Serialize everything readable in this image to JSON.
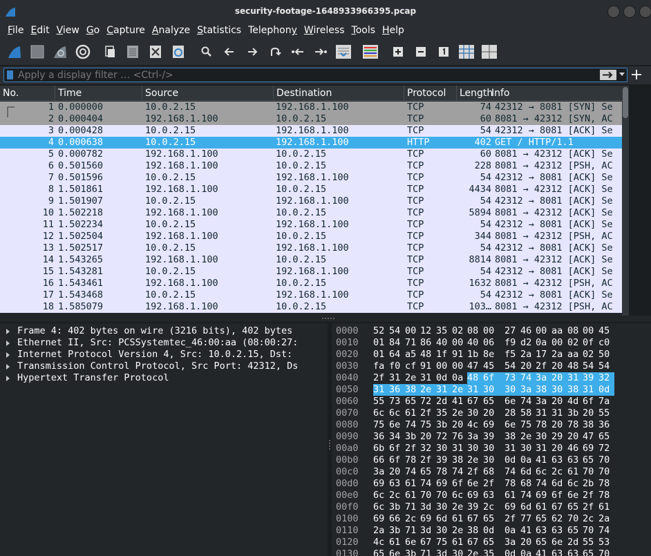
{
  "window": {
    "title": "security-footage-1648933966395.pcap"
  },
  "menu": [
    {
      "pre": "",
      "u": "F",
      "post": "ile"
    },
    {
      "pre": "",
      "u": "E",
      "post": "dit"
    },
    {
      "pre": "",
      "u": "V",
      "post": "iew"
    },
    {
      "pre": "",
      "u": "G",
      "post": "o"
    },
    {
      "pre": "",
      "u": "C",
      "post": "apture"
    },
    {
      "pre": "",
      "u": "A",
      "post": "nalyze"
    },
    {
      "pre": "",
      "u": "S",
      "post": "tatistics"
    },
    {
      "pre": "Telephon",
      "u": "y",
      "post": ""
    },
    {
      "pre": "",
      "u": "W",
      "post": "ireless"
    },
    {
      "pre": "",
      "u": "T",
      "post": "ools"
    },
    {
      "pre": "",
      "u": "H",
      "post": "elp"
    }
  ],
  "filter": {
    "placeholder": "Apply a display filter … <Ctrl-/>"
  },
  "columns": [
    "No.",
    "Time",
    "Source",
    "Destination",
    "Protocol",
    "Length",
    "Info"
  ],
  "packets": [
    {
      "no": "1",
      "time": "0.000000",
      "src": "10.0.2.15",
      "dst": "192.168.1.100",
      "proto": "TCP",
      "len": "74",
      "info": "42312 → 8081 [SYN] Se"
    },
    {
      "no": "2",
      "time": "0.000404",
      "src": "192.168.1.100",
      "dst": "10.0.2.15",
      "proto": "TCP",
      "len": "60",
      "info": "8081 → 42312 [SYN, AC"
    },
    {
      "no": "3",
      "time": "0.000428",
      "src": "10.0.2.15",
      "dst": "192.168.1.100",
      "proto": "TCP",
      "len": "54",
      "info": "42312 → 8081 [ACK] Se"
    },
    {
      "no": "4",
      "time": "0.000638",
      "src": "10.0.2.15",
      "dst": "192.168.1.100",
      "proto": "HTTP",
      "len": "402",
      "info": "GET / HTTP/1.1"
    },
    {
      "no": "5",
      "time": "0.000782",
      "src": "192.168.1.100",
      "dst": "10.0.2.15",
      "proto": "TCP",
      "len": "60",
      "info": "8081 → 42312 [ACK] Se"
    },
    {
      "no": "6",
      "time": "0.501560",
      "src": "192.168.1.100",
      "dst": "10.0.2.15",
      "proto": "TCP",
      "len": "228",
      "info": "8081 → 42312 [PSH, AC"
    },
    {
      "no": "7",
      "time": "0.501596",
      "src": "10.0.2.15",
      "dst": "192.168.1.100",
      "proto": "TCP",
      "len": "54",
      "info": "42312 → 8081 [ACK] Se"
    },
    {
      "no": "8",
      "time": "1.501861",
      "src": "192.168.1.100",
      "dst": "10.0.2.15",
      "proto": "TCP",
      "len": "4434",
      "info": "8081 → 42312 [ACK] Se"
    },
    {
      "no": "9",
      "time": "1.501907",
      "src": "10.0.2.15",
      "dst": "192.168.1.100",
      "proto": "TCP",
      "len": "54",
      "info": "42312 → 8081 [ACK] Se"
    },
    {
      "no": "10",
      "time": "1.502218",
      "src": "192.168.1.100",
      "dst": "10.0.2.15",
      "proto": "TCP",
      "len": "5894",
      "info": "8081 → 42312 [ACK] Se"
    },
    {
      "no": "11",
      "time": "1.502234",
      "src": "10.0.2.15",
      "dst": "192.168.1.100",
      "proto": "TCP",
      "len": "54",
      "info": "42312 → 8081 [ACK] Se"
    },
    {
      "no": "12",
      "time": "1.502504",
      "src": "192.168.1.100",
      "dst": "10.0.2.15",
      "proto": "TCP",
      "len": "344",
      "info": "8081 → 42312 [PSH, AC"
    },
    {
      "no": "13",
      "time": "1.502517",
      "src": "10.0.2.15",
      "dst": "192.168.1.100",
      "proto": "TCP",
      "len": "54",
      "info": "42312 → 8081 [ACK] Se"
    },
    {
      "no": "14",
      "time": "1.543265",
      "src": "192.168.1.100",
      "dst": "10.0.2.15",
      "proto": "TCP",
      "len": "8814",
      "info": "8081 → 42312 [ACK] Se"
    },
    {
      "no": "15",
      "time": "1.543281",
      "src": "10.0.2.15",
      "dst": "192.168.1.100",
      "proto": "TCP",
      "len": "54",
      "info": "42312 → 8081 [ACK] Se"
    },
    {
      "no": "16",
      "time": "1.543461",
      "src": "192.168.1.100",
      "dst": "10.0.2.15",
      "proto": "TCP",
      "len": "1632",
      "info": "8081 → 42312 [PSH, AC"
    },
    {
      "no": "17",
      "time": "1.543468",
      "src": "10.0.2.15",
      "dst": "192.168.1.100",
      "proto": "TCP",
      "len": "54",
      "info": "42312 → 8081 [ACK] Se"
    },
    {
      "no": "18",
      "time": "1.585079",
      "src": "192.168.1.100",
      "dst": "10.0.2.15",
      "proto": "TCP",
      "len": "103…",
      "info": "8081 → 42312 [PSH, AC"
    }
  ],
  "details": [
    "Frame 4: 402 bytes on wire (3216 bits), 402 bytes",
    "Ethernet II, Src: PCSSystemtec_46:00:aa (08:00:27:",
    "Internet Protocol Version 4, Src: 10.0.2.15, Dst:",
    "Transmission Control Protocol, Src Port: 42312, Ds",
    "Hypertext Transfer Protocol"
  ],
  "bytes": [
    {
      "off": "0000",
      "hex": [
        "52",
        "54",
        "00",
        "12",
        "35",
        "02",
        "08",
        "00",
        "27",
        "46",
        "00",
        "aa",
        "08",
        "00",
        "45"
      ]
    },
    {
      "off": "0010",
      "hex": [
        "01",
        "84",
        "71",
        "86",
        "40",
        "00",
        "40",
        "06",
        "f9",
        "d2",
        "0a",
        "00",
        "02",
        "0f",
        "c0"
      ]
    },
    {
      "off": "0020",
      "hex": [
        "01",
        "64",
        "a5",
        "48",
        "1f",
        "91",
        "1b",
        "8e",
        "f5",
        "2a",
        "17",
        "2a",
        "aa",
        "02",
        "50"
      ]
    },
    {
      "off": "0030",
      "hex": [
        "fa",
        "f0",
        "cf",
        "91",
        "00",
        "00",
        "47",
        "45",
        "54",
        "20",
        "2f",
        "20",
        "48",
        "54",
        "54"
      ]
    },
    {
      "off": "0040",
      "hex": [
        "2f",
        "31",
        "2e",
        "31",
        "0d",
        "0a",
        "48",
        "6f",
        "73",
        "74",
        "3a",
        "20",
        "31",
        "39",
        "32"
      ]
    },
    {
      "off": "0050",
      "hex": [
        "31",
        "36",
        "38",
        "2e",
        "31",
        "2e",
        "31",
        "30",
        "30",
        "3a",
        "38",
        "30",
        "38",
        "31",
        "0d"
      ]
    },
    {
      "off": "0060",
      "hex": [
        "55",
        "73",
        "65",
        "72",
        "2d",
        "41",
        "67",
        "65",
        "6e",
        "74",
        "3a",
        "20",
        "4d",
        "6f",
        "7a"
      ]
    },
    {
      "off": "0070",
      "hex": [
        "6c",
        "6c",
        "61",
        "2f",
        "35",
        "2e",
        "30",
        "20",
        "28",
        "58",
        "31",
        "31",
        "3b",
        "20",
        "55"
      ]
    },
    {
      "off": "0080",
      "hex": [
        "75",
        "6e",
        "74",
        "75",
        "3b",
        "20",
        "4c",
        "69",
        "6e",
        "75",
        "78",
        "20",
        "78",
        "38",
        "36"
      ]
    },
    {
      "off": "0090",
      "hex": [
        "36",
        "34",
        "3b",
        "20",
        "72",
        "76",
        "3a",
        "39",
        "38",
        "2e",
        "30",
        "29",
        "20",
        "47",
        "65"
      ]
    },
    {
      "off": "00a0",
      "hex": [
        "6b",
        "6f",
        "2f",
        "32",
        "30",
        "31",
        "30",
        "30",
        "31",
        "30",
        "31",
        "20",
        "46",
        "69",
        "72"
      ]
    },
    {
      "off": "00b0",
      "hex": [
        "66",
        "6f",
        "78",
        "2f",
        "39",
        "38",
        "2e",
        "30",
        "0d",
        "0a",
        "41",
        "63",
        "63",
        "65",
        "70"
      ]
    },
    {
      "off": "00c0",
      "hex": [
        "3a",
        "20",
        "74",
        "65",
        "78",
        "74",
        "2f",
        "68",
        "74",
        "6d",
        "6c",
        "2c",
        "61",
        "70",
        "70"
      ]
    },
    {
      "off": "00d0",
      "hex": [
        "69",
        "63",
        "61",
        "74",
        "69",
        "6f",
        "6e",
        "2f",
        "78",
        "68",
        "74",
        "6d",
        "6c",
        "2b",
        "78"
      ]
    },
    {
      "off": "00e0",
      "hex": [
        "6c",
        "2c",
        "61",
        "70",
        "70",
        "6c",
        "69",
        "63",
        "61",
        "74",
        "69",
        "6f",
        "6e",
        "2f",
        "78"
      ]
    },
    {
      "off": "00f0",
      "hex": [
        "6c",
        "3b",
        "71",
        "3d",
        "30",
        "2e",
        "39",
        "2c",
        "69",
        "6d",
        "61",
        "67",
        "65",
        "2f",
        "61"
      ]
    },
    {
      "off": "0100",
      "hex": [
        "69",
        "66",
        "2c",
        "69",
        "6d",
        "61",
        "67",
        "65",
        "2f",
        "77",
        "65",
        "62",
        "70",
        "2c",
        "2a"
      ]
    },
    {
      "off": "0110",
      "hex": [
        "2a",
        "3b",
        "71",
        "3d",
        "30",
        "2e",
        "38",
        "0d",
        "0a",
        "41",
        "63",
        "63",
        "65",
        "70",
        "74"
      ]
    },
    {
      "off": "0120",
      "hex": [
        "4c",
        "61",
        "6e",
        "67",
        "75",
        "61",
        "67",
        "65",
        "3a",
        "20",
        "65",
        "6e",
        "2d",
        "55",
        "53"
      ]
    },
    {
      "off": "0130",
      "hex": [
        "65",
        "6e",
        "3b",
        "71",
        "3d",
        "30",
        "2e",
        "35",
        "0d",
        "0a",
        "41",
        "63",
        "63",
        "65",
        "70"
      ]
    }
  ],
  "colors": {
    "selected_row": "#3daee9",
    "syn_row": "#a0a0a0",
    "tcp_row": "#e7e6ff",
    "http_row": "#e4ffc7",
    "row_text": "#12272e"
  }
}
